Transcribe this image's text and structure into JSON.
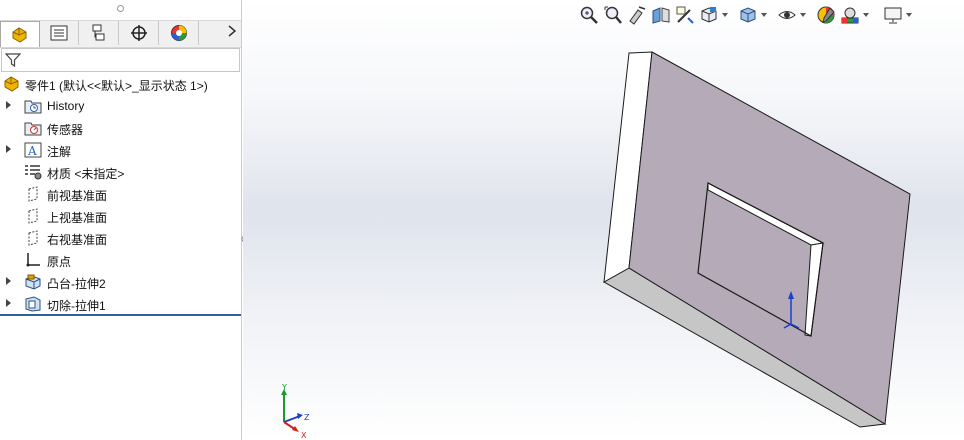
{
  "panel": {
    "tabs": [
      {
        "name": "featuremanager-tab",
        "icon": "part-tree-icon"
      },
      {
        "name": "propertymanager-tab",
        "icon": "property-list-icon"
      },
      {
        "name": "configurationmanager-tab",
        "icon": "configuration-icon"
      },
      {
        "name": "dimxpert-tab",
        "icon": "crosshair-icon"
      },
      {
        "name": "display-manager-tab",
        "icon": "color-wheel-icon"
      }
    ],
    "tree": {
      "root": "零件1  (默认<<默认>_显示状态 1>)",
      "items": [
        {
          "label": "History",
          "expandable": true,
          "icon": "history-folder-icon"
        },
        {
          "label": "传感器",
          "expandable": false,
          "icon": "sensor-folder-icon"
        },
        {
          "label": "注解",
          "expandable": true,
          "icon": "annotations-icon"
        },
        {
          "label": "材质 <未指定>",
          "expandable": false,
          "icon": "material-icon"
        },
        {
          "label": "前视基准面",
          "expandable": false,
          "icon": "plane-icon"
        },
        {
          "label": "上视基准面",
          "expandable": false,
          "icon": "plane-icon"
        },
        {
          "label": "右视基准面",
          "expandable": false,
          "icon": "plane-icon"
        },
        {
          "label": "原点",
          "expandable": false,
          "icon": "origin-icon"
        },
        {
          "label": "凸台-拉伸2",
          "expandable": true,
          "icon": "boss-extrude-icon"
        },
        {
          "label": "切除-拉伸1",
          "expandable": true,
          "icon": "cut-extrude-icon"
        }
      ]
    }
  },
  "view_toolbar": [
    "zoom-to-fit-icon",
    "zoom-to-area-icon",
    "previous-view-icon",
    "section-view-icon",
    "dynamic-annotation-icon",
    "view-orientation-icon",
    "display-style-icon",
    "hide-show-items-icon",
    "edit-appearance-icon",
    "apply-scene-icon",
    "view-settings-icon"
  ],
  "triad": {
    "x": "X",
    "y": "Y",
    "z": "Z"
  },
  "colors": {
    "face_front": "#b5abb8",
    "face_side": "#ffffff",
    "face_bottom": "#c3c3c3",
    "edge": "#1a1a1a",
    "rollback": "#2f5fa0"
  }
}
